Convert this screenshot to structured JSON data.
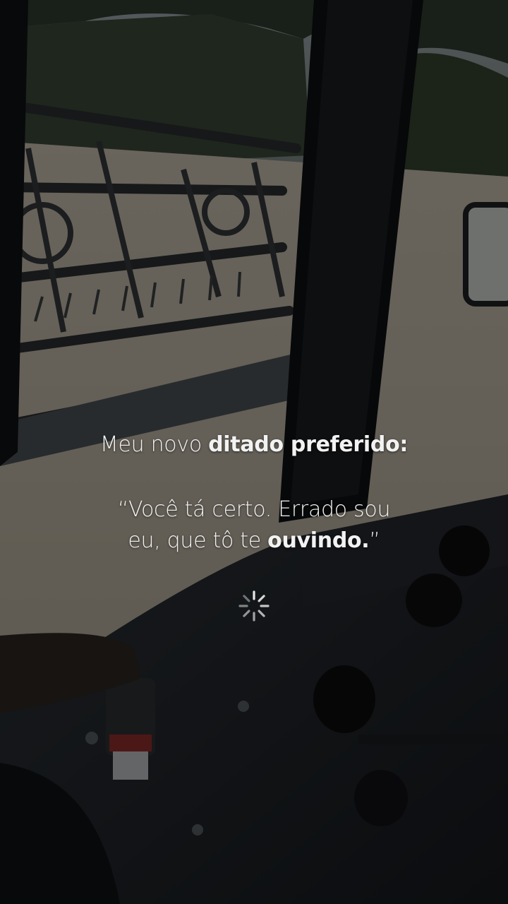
{
  "caption": {
    "headline_prefix": "Meu novo",
    "headline_bold": "ditado preferido:",
    "quote_line1": "“Você tá certo. Errado sou",
    "quote_line2_prefix": "eu, que tô te",
    "quote_line2_bold": "ouvindo.",
    "quote_line2_close": "”"
  },
  "loading_indicator": {
    "icon": "spinner-icon"
  },
  "colors": {
    "text": "#f2f2f2",
    "dim_overlay": "#000000"
  }
}
